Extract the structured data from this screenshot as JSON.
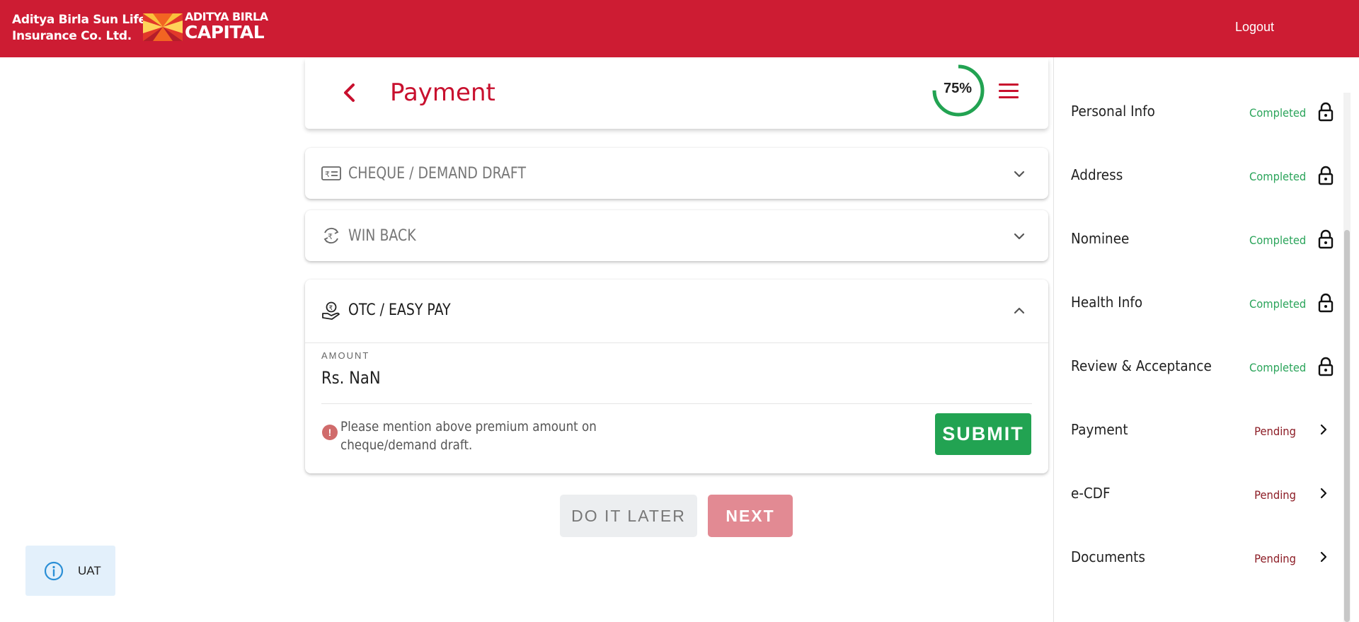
{
  "header": {
    "brand_line1": "Aditya Birla Sun Life",
    "brand_line2": "Insurance Co. Ltd.",
    "logo_line1": "ADITYA BIRLA",
    "logo_line2": "CAPITAL",
    "logout_label": "Logout"
  },
  "page": {
    "title": "Payment",
    "progress_label": "75%",
    "progress_value": 0.75
  },
  "accordions": [
    {
      "label": "CHEQUE / DEMAND DRAFT",
      "icon": "cheque-icon",
      "expanded": false
    },
    {
      "label": "WIN BACK",
      "icon": "rupee-refresh-icon",
      "expanded": false
    },
    {
      "label": "OTC / EASY PAY",
      "icon": "hand-coin-icon",
      "expanded": true
    }
  ],
  "otc": {
    "amount_label": "AMOUNT",
    "amount_value": "Rs. NaN",
    "note": "Please mention above premium amount on cheque/demand draft.",
    "submit_label": "SUBMIT"
  },
  "actions": {
    "later_label": "DO IT LATER",
    "next_label": "NEXT"
  },
  "env_badge": {
    "label": "UAT"
  },
  "sidebar": {
    "items": [
      {
        "label": "Personal Info",
        "status": "Completed"
      },
      {
        "label": "Address",
        "status": "Completed"
      },
      {
        "label": "Nominee",
        "status": "Completed"
      },
      {
        "label": "Health Info",
        "status": "Completed"
      },
      {
        "label": "Review & Acceptance",
        "status": "Completed"
      },
      {
        "label": "Payment",
        "status": "Pending"
      },
      {
        "label": "e-CDF",
        "status": "Pending"
      },
      {
        "label": "Documents",
        "status": "Pending"
      }
    ]
  },
  "colors": {
    "brand_red": "#cd1c33",
    "success_green": "#22a352",
    "pending_red": "#8c1c25"
  }
}
